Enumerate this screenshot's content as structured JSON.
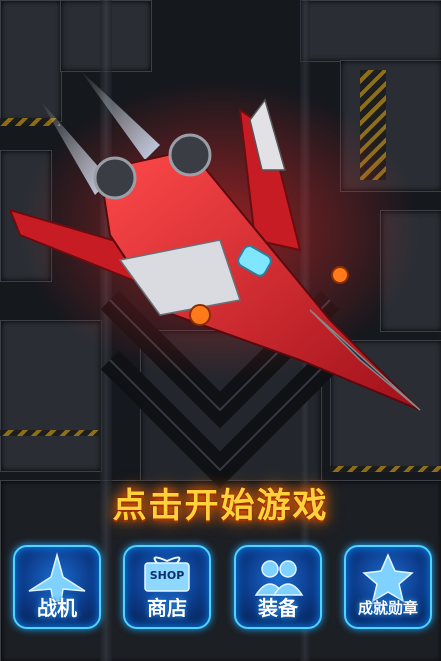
{
  "title": "点击开始游戏",
  "menu": [
    {
      "label": "战机",
      "icon": "fighter-jet-icon"
    },
    {
      "label": "商店",
      "icon": "gift-box-shop-icon",
      "tag": "SHOP"
    },
    {
      "label": "装备",
      "icon": "users-icon"
    },
    {
      "label": "成就勋章",
      "icon": "star-medal-icon"
    }
  ],
  "colors": {
    "title": "#ffd23a",
    "button_border": "#4fd3ff",
    "button_fill": "#0c3a88",
    "jet_red": "#d6202a"
  }
}
